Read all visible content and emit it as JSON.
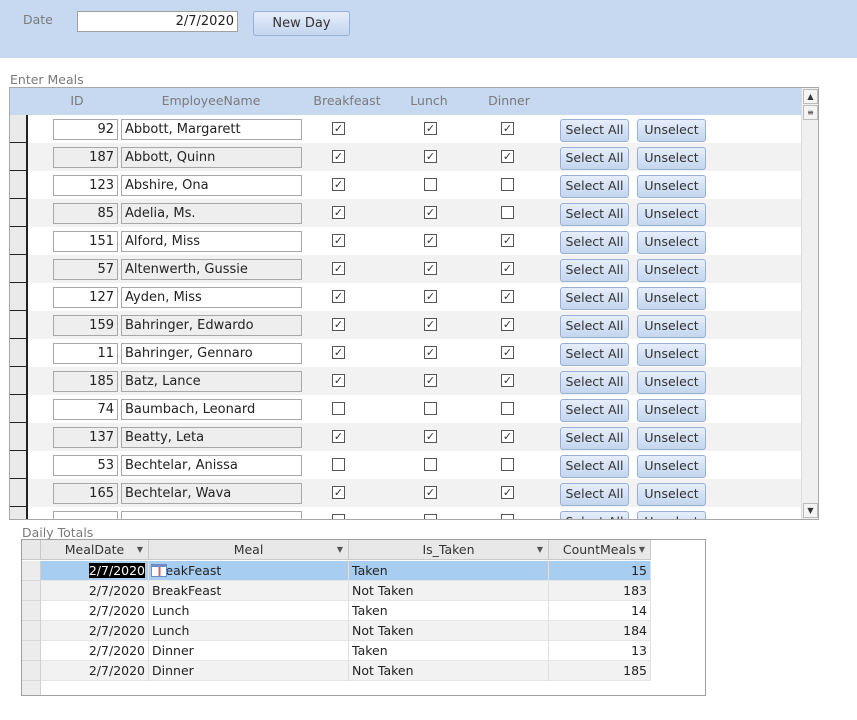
{
  "header": {
    "date_label": "Date",
    "date_value": "2/7/2020",
    "new_day_label": "New Day",
    "background": "#c6d9f0"
  },
  "enter_meals": {
    "title": "Enter Meals",
    "columns": [
      "ID",
      "EmployeeName",
      "Breakfeast",
      "Lunch",
      "Dinner"
    ],
    "select_all_label": "Select All",
    "unselect_label": "Unselect",
    "rows": [
      {
        "id": "92",
        "name": "Abbott, Margarett",
        "breakfast": true,
        "lunch": true,
        "dinner": true
      },
      {
        "id": "187",
        "name": "Abbott, Quinn",
        "breakfast": true,
        "lunch": true,
        "dinner": true
      },
      {
        "id": "123",
        "name": "Abshire, Ona",
        "breakfast": true,
        "lunch": false,
        "dinner": false
      },
      {
        "id": "85",
        "name": "Adelia, Ms.",
        "breakfast": true,
        "lunch": true,
        "dinner": false
      },
      {
        "id": "151",
        "name": "Alford, Miss",
        "breakfast": true,
        "lunch": true,
        "dinner": true
      },
      {
        "id": "57",
        "name": "Altenwerth, Gussie",
        "breakfast": true,
        "lunch": true,
        "dinner": true
      },
      {
        "id": "127",
        "name": "Ayden, Miss",
        "breakfast": true,
        "lunch": true,
        "dinner": true
      },
      {
        "id": "159",
        "name": "Bahringer, Edwardo",
        "breakfast": true,
        "lunch": true,
        "dinner": true
      },
      {
        "id": "11",
        "name": "Bahringer, Gennaro",
        "breakfast": true,
        "lunch": true,
        "dinner": true
      },
      {
        "id": "185",
        "name": "Batz, Lance",
        "breakfast": true,
        "lunch": true,
        "dinner": true
      },
      {
        "id": "74",
        "name": "Baumbach, Leonard",
        "breakfast": false,
        "lunch": false,
        "dinner": false
      },
      {
        "id": "137",
        "name": "Beatty, Leta",
        "breakfast": true,
        "lunch": true,
        "dinner": true
      },
      {
        "id": "53",
        "name": "Bechtelar, Anissa",
        "breakfast": false,
        "lunch": false,
        "dinner": false
      },
      {
        "id": "165",
        "name": "Bechtelar, Wava",
        "breakfast": true,
        "lunch": true,
        "dinner": true
      },
      {
        "id": "",
        "name": "",
        "breakfast": false,
        "lunch": false,
        "dinner": false
      }
    ]
  },
  "daily_totals": {
    "title": "Daily Totals",
    "columns": [
      "MealDate",
      "Meal",
      "Is_Taken",
      "CountMeals"
    ],
    "rows": [
      {
        "date": "2/7/2020",
        "meal": "BreakFeast",
        "taken": "Taken",
        "count": "15"
      },
      {
        "date": "2/7/2020",
        "meal": "BreakFeast",
        "taken": "Not Taken",
        "count": "183"
      },
      {
        "date": "2/7/2020",
        "meal": "Lunch",
        "taken": "Taken",
        "count": "14"
      },
      {
        "date": "2/7/2020",
        "meal": "Lunch",
        "taken": "Not Taken",
        "count": "184"
      },
      {
        "date": "2/7/2020",
        "meal": "Dinner",
        "taken": "Taken",
        "count": "13"
      },
      {
        "date": "2/7/2020",
        "meal": "Dinner",
        "taken": "Not Taken",
        "count": "185"
      }
    ],
    "selected_color": "#a7cdf0"
  }
}
